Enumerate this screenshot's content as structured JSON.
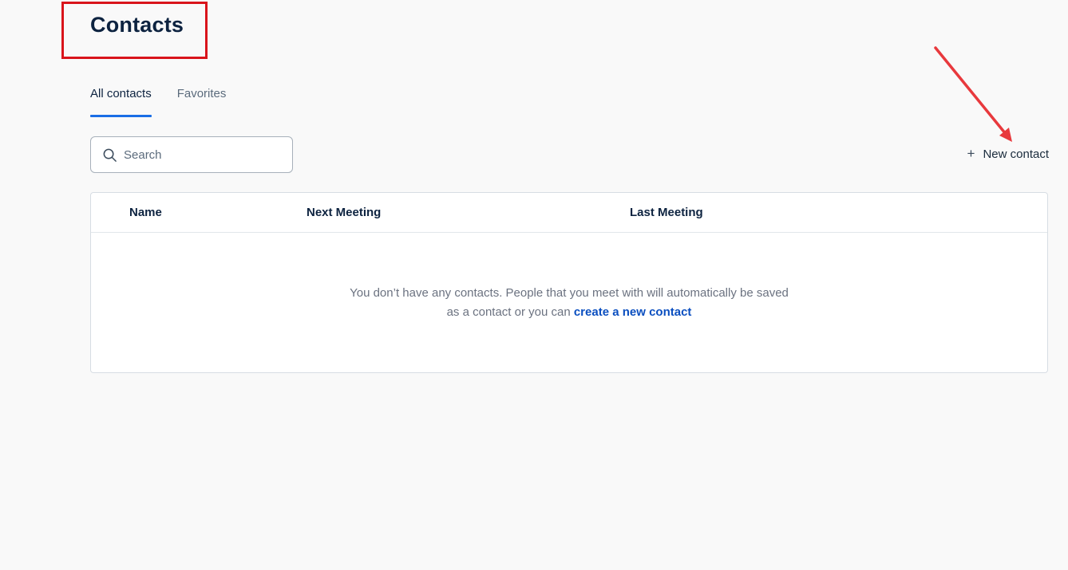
{
  "header": {
    "title": "Contacts"
  },
  "tabs": [
    {
      "label": "All contacts",
      "active": true
    },
    {
      "label": "Favorites",
      "active": false
    }
  ],
  "search": {
    "placeholder": "Search",
    "value": "",
    "icon": "search-icon"
  },
  "new_contact": {
    "icon": "plus-icon",
    "label": "New contact"
  },
  "table": {
    "columns": [
      "Name",
      "Next Meeting",
      "Last Meeting"
    ],
    "rows": [],
    "empty": {
      "text_line1": "You don’t have any contacts. People that you meet with will automatically be saved",
      "text_line2": "as a contact or you can ",
      "link_label": "create a new contact"
    }
  },
  "colors": {
    "accent": "#1a6ee6",
    "link": "#0b4fc0",
    "annotation": "#d9141b"
  }
}
